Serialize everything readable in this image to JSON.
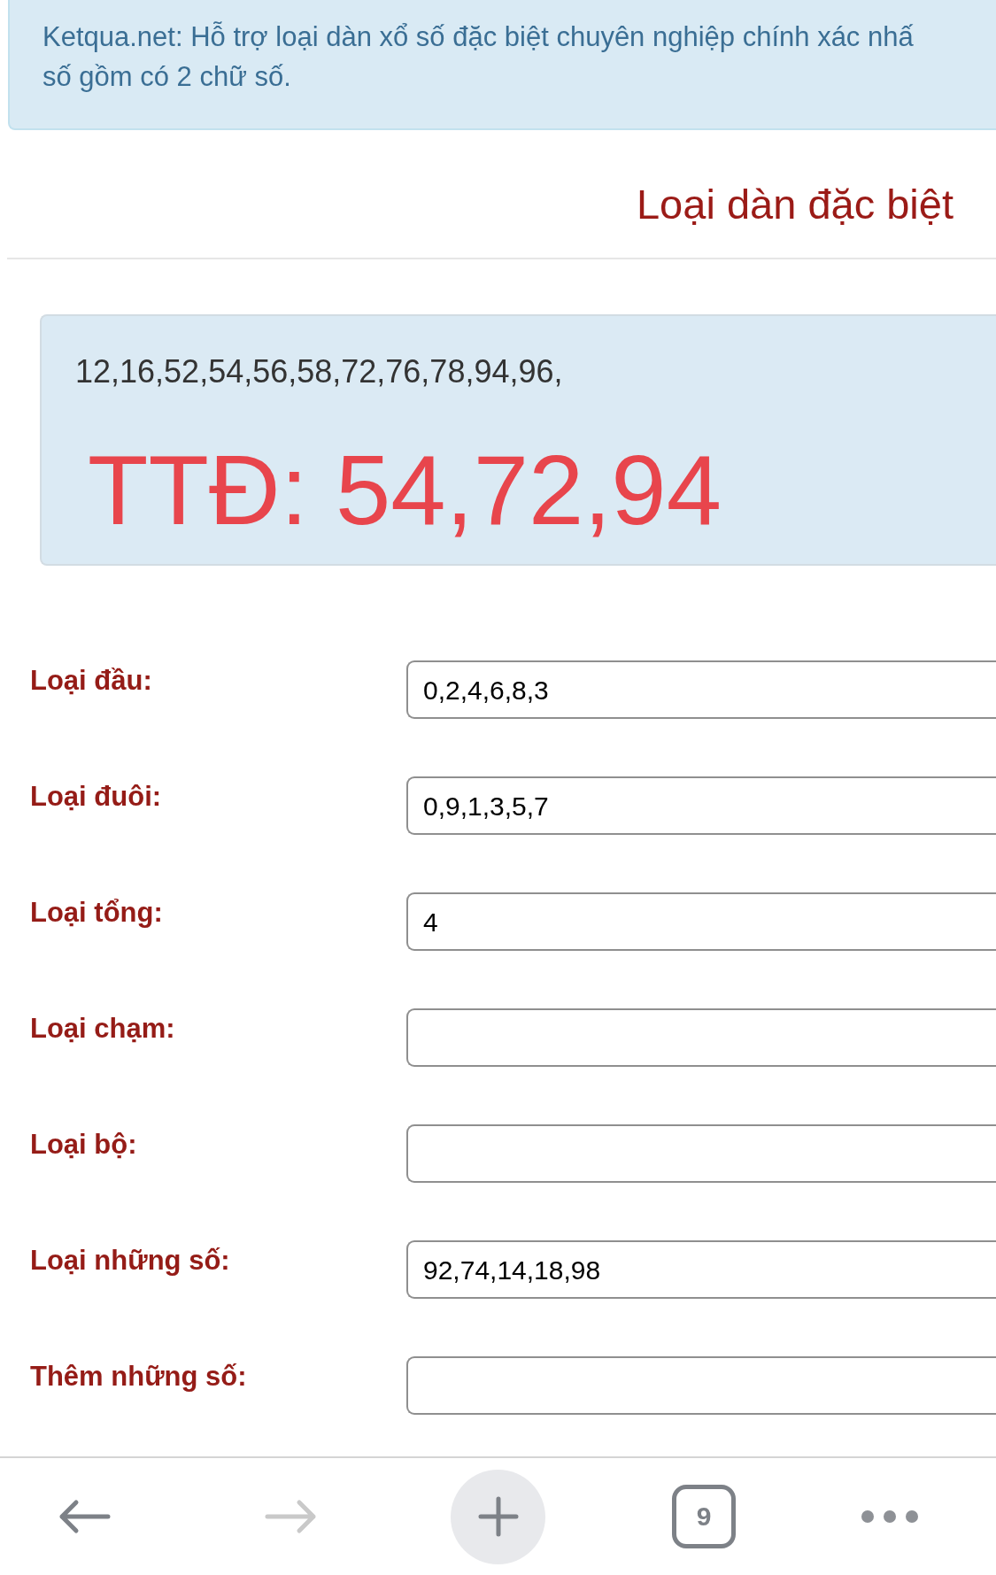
{
  "info_banner": {
    "lines": [
      "Ketqua.net: Hỗ trợ loại dàn xổ số đặc biệt chuyên nghiệp chính xác nhấ",
      "số gồm có 2 chữ số."
    ]
  },
  "heading": "Loại dàn đặc biệt",
  "result": {
    "numbers": "12,16,52,54,56,58,72,76,78,94,96,",
    "highlight": "TTĐ: 54,72,94"
  },
  "fields": [
    {
      "label": "Loại đầu:",
      "value": "0,2,4,6,8,3"
    },
    {
      "label": "Loại đuôi:",
      "value": "0,9,1,3,5,7"
    },
    {
      "label": "Loại tổng:",
      "value": "4"
    },
    {
      "label": "Loại chạm:"
    },
    {
      "label": "Loại bộ:"
    },
    {
      "label": "Loại những số:",
      "value": "92,74,14,18,98"
    },
    {
      "label": "Thêm những số:"
    }
  ],
  "toolbar": [
    {
      "kind": "back",
      "disabled": false
    },
    {
      "kind": "forward",
      "disabled": true
    },
    {
      "kind": "new_tab"
    },
    {
      "kind": "tabs",
      "count": "9"
    },
    {
      "kind": "more"
    }
  ]
}
